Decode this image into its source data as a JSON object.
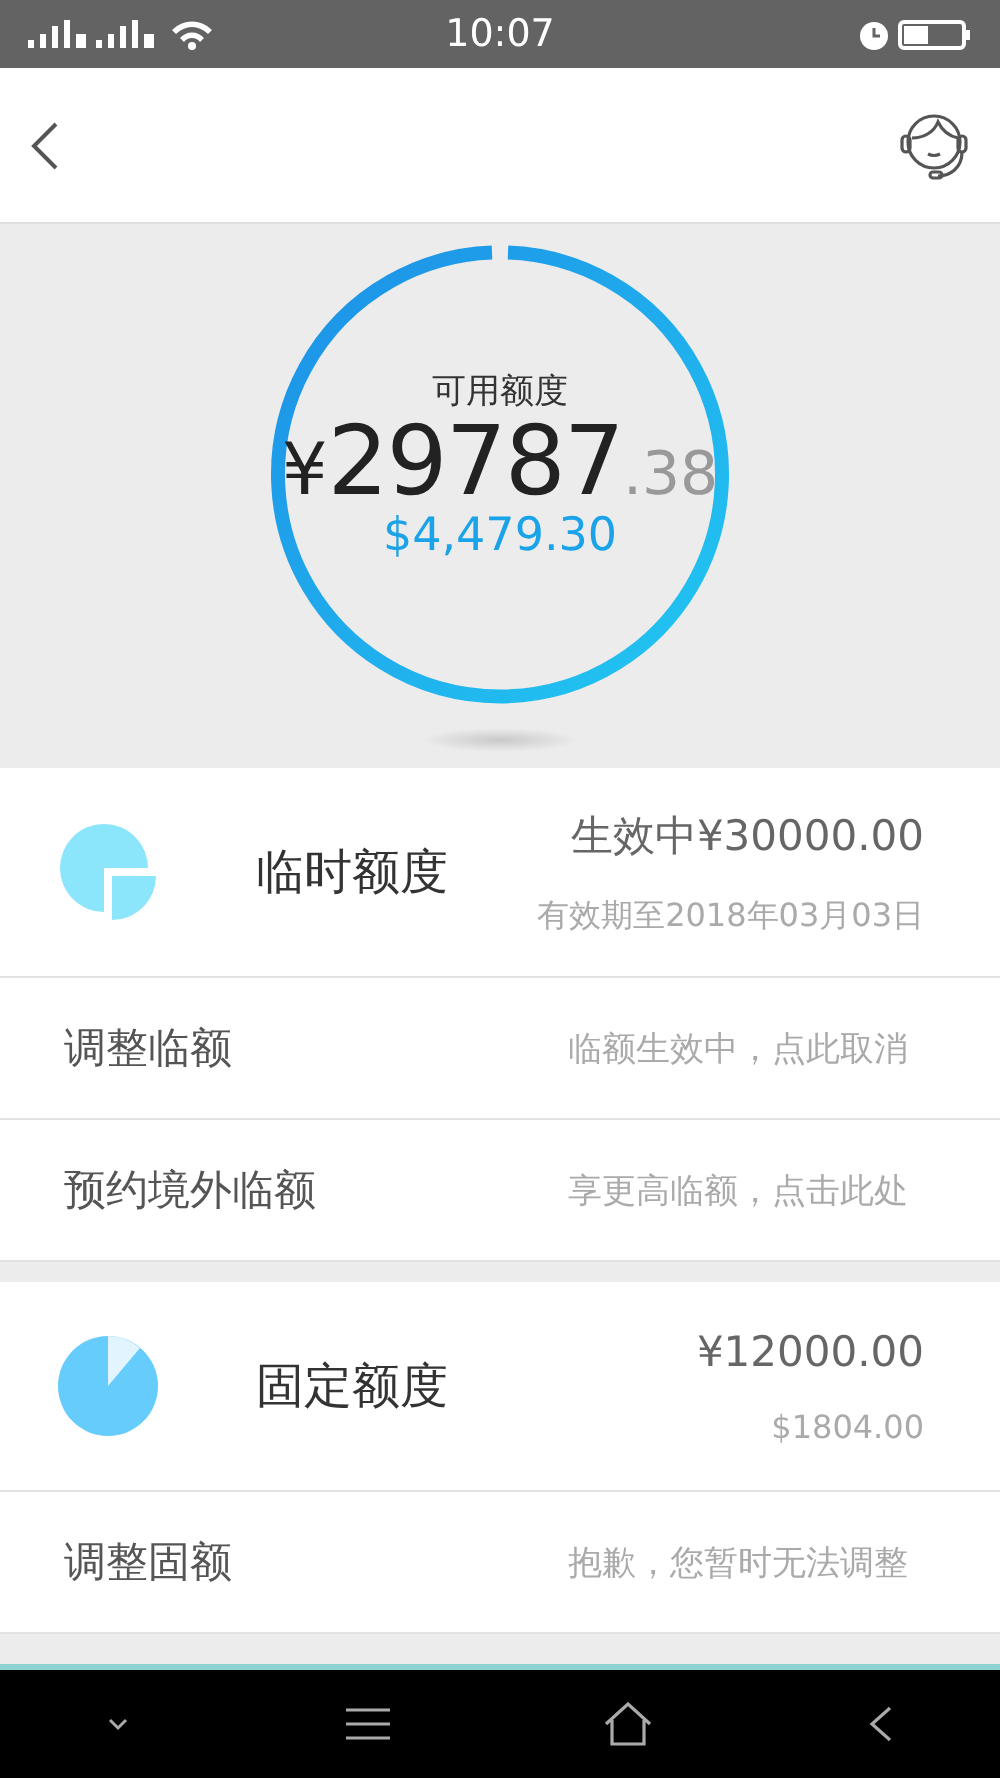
{
  "status_bar": {
    "time": "10:07"
  },
  "balance": {
    "label": "可用额度",
    "currency": "¥",
    "integer": "29787",
    "decimal": ".38",
    "usd": "$4,479.30"
  },
  "sections": [
    {
      "kind": "temporary",
      "title": "临时额度",
      "amount": "生效中¥30000.00",
      "note": "有效期至2018年03月03日",
      "rows": [
        {
          "label": "调整临额",
          "hint": "临额生效中，点此取消"
        },
        {
          "label": "预约境外临额",
          "hint": "享更高临额，点击此处"
        }
      ]
    },
    {
      "kind": "fixed",
      "title": "固定额度",
      "amount": "¥12000.00",
      "note": "$1804.00",
      "rows": [
        {
          "label": "调整固额",
          "hint": "抱歉，您暂时无法调整"
        }
      ]
    }
  ]
}
